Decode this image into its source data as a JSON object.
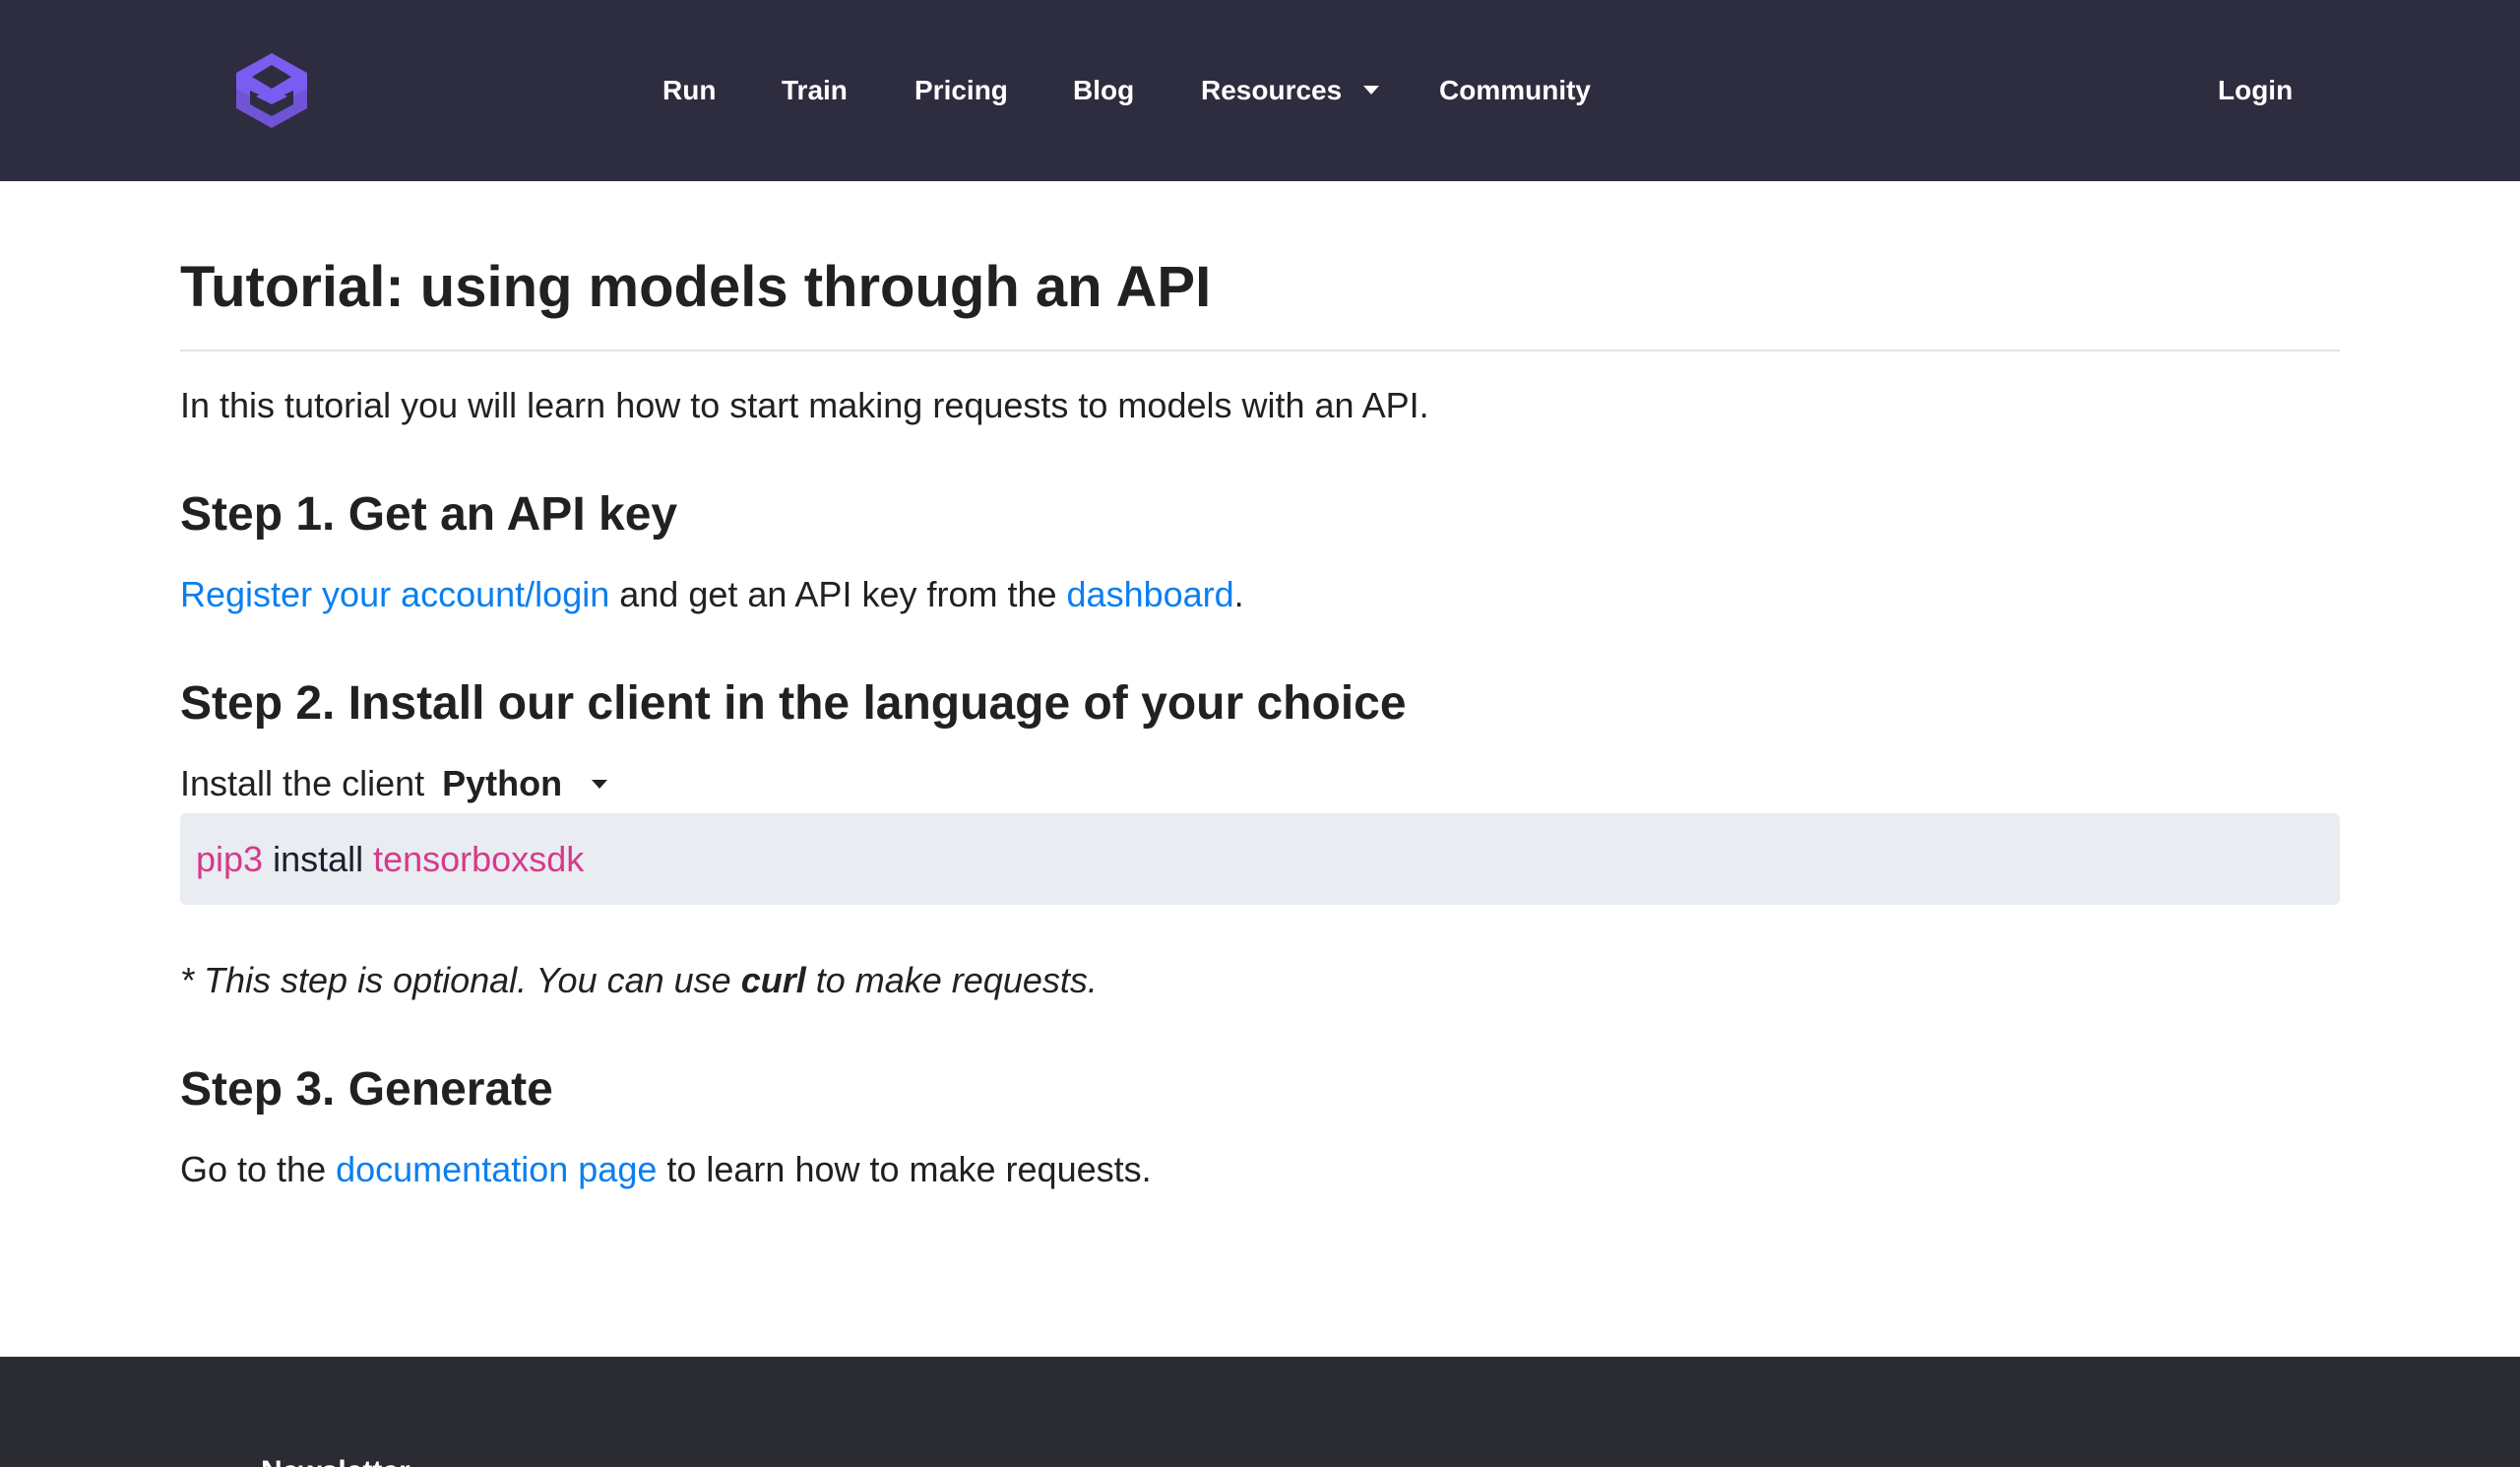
{
  "nav": {
    "items": [
      {
        "label": "Run"
      },
      {
        "label": "Train"
      },
      {
        "label": "Pricing"
      },
      {
        "label": "Blog"
      },
      {
        "label": "Resources"
      },
      {
        "label": "Community"
      }
    ],
    "login_label": "Login"
  },
  "colors": {
    "header_bg": "#2e2d3f",
    "logo": "#7b5cf0",
    "link": "#0a7ff1",
    "code_accent": "#d63a8a",
    "code_bg": "#e9ecf1",
    "footer_bg": "#2b2b32"
  },
  "icons": {
    "logo": "stacked-layers-logo",
    "resources_dropdown": "caret-down-icon",
    "language_dropdown": "caret-down-icon"
  },
  "page": {
    "title": "Tutorial: using models through an API",
    "intro": "In this tutorial you will learn how to start making requests to models with an API."
  },
  "step1": {
    "heading": "Step 1. Get an API key",
    "link_register": "Register your account/login",
    "text_middle": " and get an API key from the ",
    "link_dashboard": "dashboard",
    "text_end": "."
  },
  "step2": {
    "heading": "Step 2. Install our client in the language of your choice",
    "install_label": "Install the client",
    "language_selected": "Python",
    "code": {
      "cmd": "pip3",
      "word": " install ",
      "pkg": "tensorboxsdk"
    },
    "note_before": "* This step is optional. You can use ",
    "note_bold": "curl",
    "note_after": " to make requests."
  },
  "step3": {
    "heading": "Step 3. Generate",
    "text_before": "Go to the ",
    "link_docs": "documentation page",
    "text_after": " to learn how to make requests."
  },
  "footer": {
    "newsletter_heading": "Newsletter"
  }
}
